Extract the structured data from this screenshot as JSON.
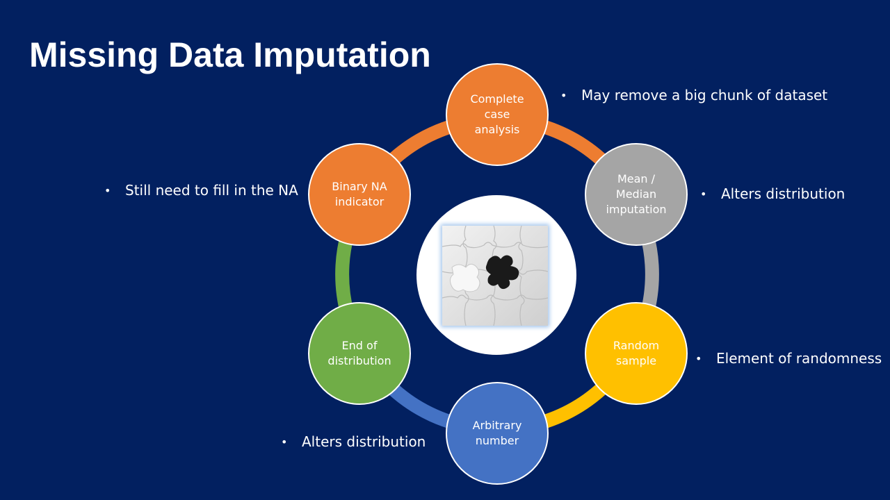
{
  "slide": {
    "title": "Missing Data Imputation"
  },
  "colors": {
    "background": "#022060",
    "orange": "#ed7d31",
    "gray": "#a5a5a5",
    "yellow": "#ffc000",
    "blue": "#4472c4",
    "green": "#70ad47"
  },
  "nodes": [
    {
      "id": "complete-case",
      "label": "Complete\ncase\nanalysis",
      "color": "#ed7d31"
    },
    {
      "id": "mean-median",
      "label": "Mean /\nMedian\nimputation",
      "color": "#a5a5a5"
    },
    {
      "id": "random-sample",
      "label": "Random\nsample",
      "color": "#ffc000"
    },
    {
      "id": "arbitrary-number",
      "label": "Arbitrary\nnumber",
      "color": "#4472c4"
    },
    {
      "id": "end-of-distribution",
      "label": "End of\ndistribution",
      "color": "#70ad47"
    },
    {
      "id": "binary-na",
      "label": "Binary NA\nindicator",
      "color": "#ed7d31"
    }
  ],
  "center_image": {
    "icon": "puzzle-icon"
  },
  "notes": [
    {
      "id": "complete-case",
      "bullet": "•",
      "text": "May remove a big chunk of dataset"
    },
    {
      "id": "mean-median",
      "bullet": "•",
      "text": "Alters distribution"
    },
    {
      "id": "random-sample",
      "bullet": "•",
      "text": "Element of randomness"
    },
    {
      "id": "arbitrary-number",
      "bullet": "•",
      "text": "Alters distribution"
    },
    {
      "id": "binary-na",
      "bullet": "•",
      "text": "Still need to fill in the NA"
    }
  ]
}
